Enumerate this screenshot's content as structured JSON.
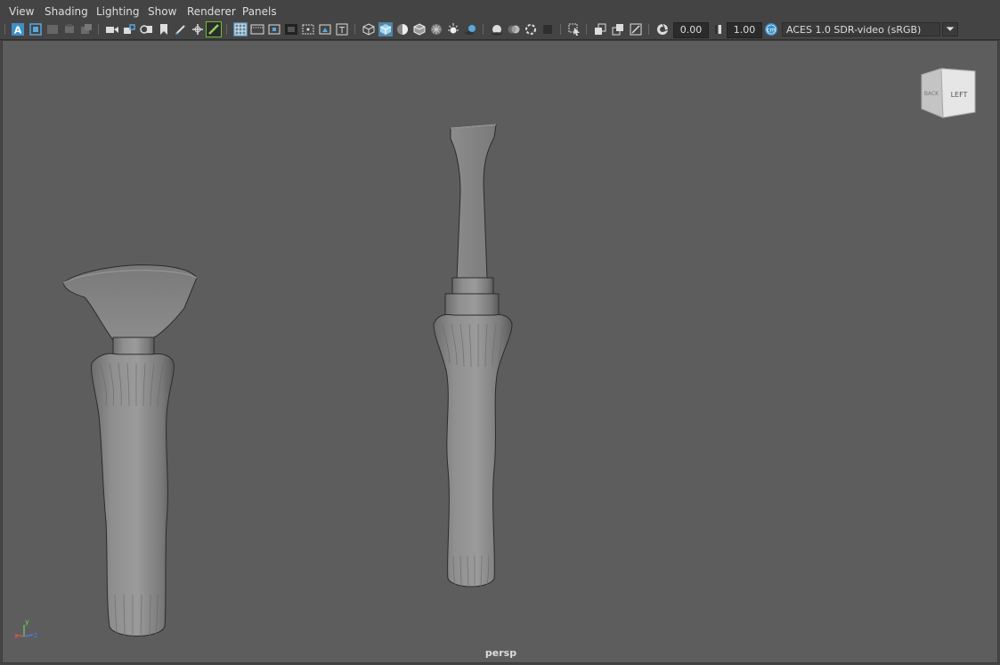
{
  "menu": {
    "view": "View",
    "shading": "Shading",
    "lighting": "Lighting",
    "show": "Show",
    "renderer": "Renderer",
    "panels": "Panels"
  },
  "toolbar": {
    "exposure_value": "0.00",
    "gamma_value": "1.00",
    "color_management_badge": "cm",
    "view_transform": "ACES 1.0 SDR-video (sRGB)"
  },
  "viewcube": {
    "face_left": "LEFT",
    "face_back": "BACK"
  },
  "axis": {
    "x": "x",
    "y": "y",
    "z": "z"
  },
  "camera_label": "persp",
  "colors": {
    "ui_background": "#444444",
    "viewport_background": "#5d5d5d",
    "accent_blue": "#3d8fc4",
    "model_grey": "#8c8c8c"
  }
}
